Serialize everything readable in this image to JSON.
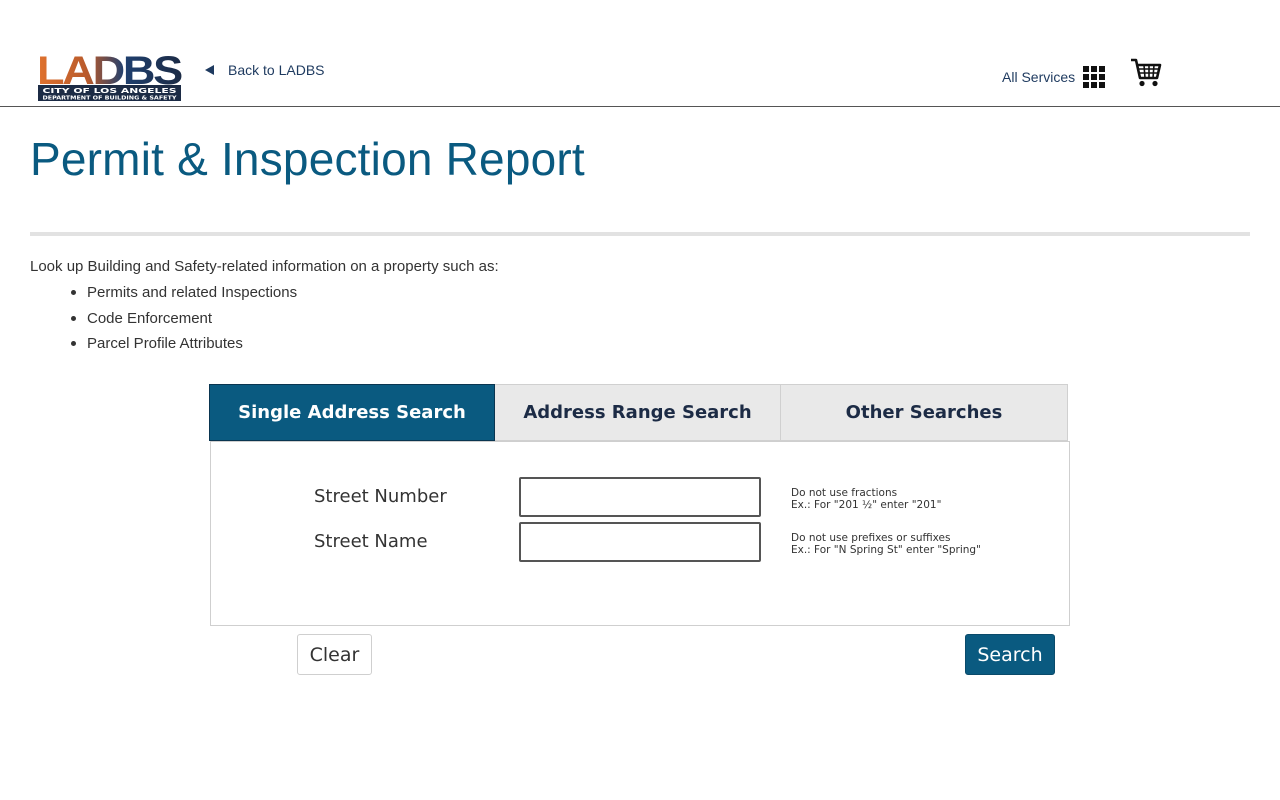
{
  "header": {
    "logo": {
      "wordmark": "LADBS",
      "line1": "CITY OF LOS ANGELES",
      "line2": "DEPARTMENT OF BUILDING & SAFETY"
    },
    "back_link": "Back to LADBS",
    "all_services": "All Services",
    "icons": [
      "triangle-left-icon",
      "grid-icon",
      "cart-icon"
    ]
  },
  "page": {
    "title": "Permit & Inspection Report",
    "intro": "Look up Building and Safety-related information on a property such as:",
    "bullets": [
      "Permits and related Inspections",
      "Code Enforcement",
      "Parcel Profile Attributes"
    ]
  },
  "tabs": [
    {
      "label": "Single Address Search",
      "active": true
    },
    {
      "label": "Address Range Search",
      "active": false
    },
    {
      "label": "Other Searches",
      "active": false
    }
  ],
  "form": {
    "street_number": {
      "label": "Street Number",
      "value": "",
      "hint_line1": "Do not use fractions",
      "hint_line2": "Ex.: For \"201 ½\" enter \"201\""
    },
    "street_name": {
      "label": "Street Name",
      "value": "",
      "hint_line1": "Do not use prefixes or suffixes",
      "hint_line2": "Ex.: For \"N Spring St\" enter \"Spring\""
    }
  },
  "buttons": {
    "clear": "Clear",
    "search": "Search"
  },
  "colors": {
    "primary": "#0a5a80",
    "navy": "#1c2b45",
    "logo_orange": "#d9632b"
  }
}
